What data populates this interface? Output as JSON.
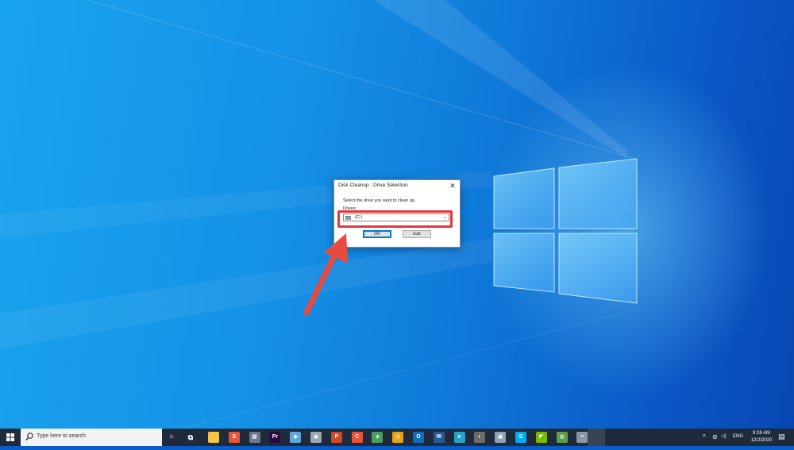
{
  "dialog": {
    "title": "Disk Cleanup : Drive Selection",
    "close_glyph": "✕",
    "prompt": "Select the drive you want to clean up.",
    "drives_label": "Drives:",
    "selected_drive": "(C:)",
    "ok_label": "OK",
    "exit_label": "Exit"
  },
  "taskbar": {
    "search_placeholder": "Type here to search",
    "cortana_glyph": "○",
    "task_view_glyph": "⧉",
    "apps": [
      {
        "name": "file-explorer",
        "glyph": "",
        "color": "#f3c64a"
      },
      {
        "name": "app-s",
        "glyph": "S",
        "color": "#e8533a"
      },
      {
        "name": "calculator",
        "glyph": "▦",
        "color": "#6b7a8c"
      },
      {
        "name": "premiere-pro",
        "glyph": "Pr",
        "color": "#2a0a3e"
      },
      {
        "name": "app-a",
        "glyph": "◆",
        "color": "#5fa8d9"
      },
      {
        "name": "app-b",
        "glyph": "◉",
        "color": "#9aa7b5"
      },
      {
        "name": "powerpoint",
        "glyph": "P",
        "color": "#d24726"
      },
      {
        "name": "app-c",
        "glyph": "C",
        "color": "#e8533a"
      },
      {
        "name": "app-d",
        "glyph": "◈",
        "color": "#4b9e5f"
      },
      {
        "name": "chrome",
        "glyph": "◎",
        "color": "#e3a21a"
      },
      {
        "name": "outlook",
        "glyph": "O",
        "color": "#0f6cbd"
      },
      {
        "name": "word",
        "glyph": "W",
        "color": "#2b579a"
      },
      {
        "name": "edge",
        "glyph": "e",
        "color": "#1fa5c9"
      },
      {
        "name": "app-e",
        "glyph": "◐",
        "color": "#6b6b6b"
      },
      {
        "name": "app-f",
        "glyph": "▣",
        "color": "#8fa1b3"
      },
      {
        "name": "skype",
        "glyph": "S",
        "color": "#00aff0"
      },
      {
        "name": "nvidia",
        "glyph": "◤",
        "color": "#76b900"
      },
      {
        "name": "app-g",
        "glyph": "◍",
        "color": "#5b9f4b"
      },
      {
        "name": "disk-cleanup",
        "glyph": "≡",
        "color": "#8a96a3"
      }
    ],
    "tray": {
      "chevron": "^",
      "network": "⊜",
      "volume": "◁)",
      "language": "ENG",
      "time": "9:28 AM",
      "date": "12/2/2020",
      "notification": "▤"
    }
  },
  "colors": {
    "highlight": "#e53935",
    "arrow": "#e84a3f",
    "taskbar": "#1f2a3a"
  }
}
